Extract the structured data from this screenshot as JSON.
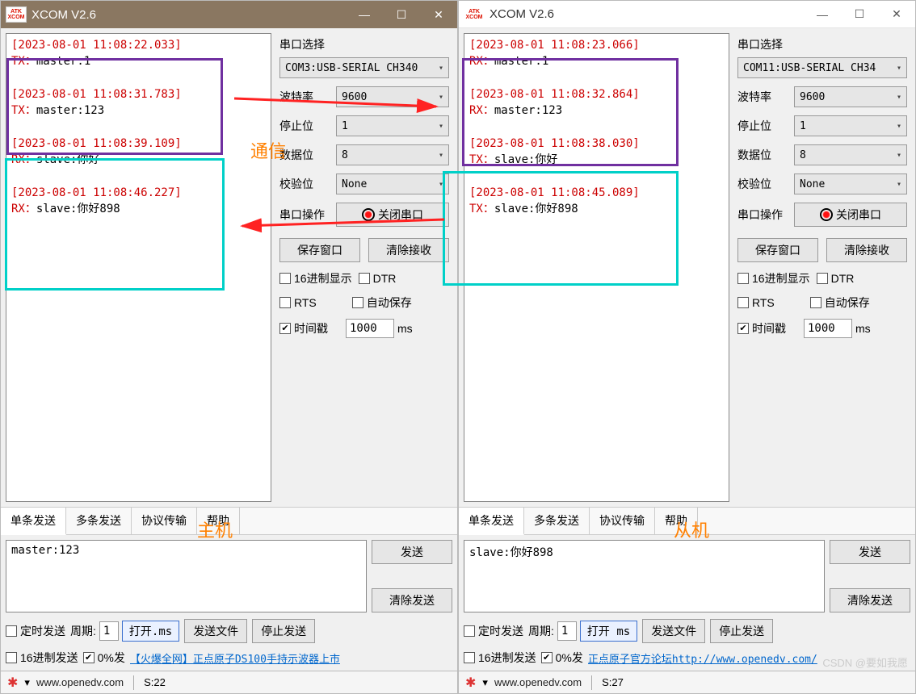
{
  "leftWin": {
    "title": "XCOM V2.6",
    "logoTop": "ATK",
    "logoBot": "XCOM",
    "recv": [
      {
        "ts": "[2023-08-01 11:08:22.033]",
        "dir": "TX：",
        "msg": "master:1"
      },
      {
        "ts": "[2023-08-01 11:08:31.783]",
        "dir": "TX：",
        "msg": "master:123"
      },
      {
        "ts": "[2023-08-01 11:08:39.109]",
        "dir": "RX：",
        "msg": "slave:你好"
      },
      {
        "ts": "[2023-08-01 11:08:46.227]",
        "dir": "RX：",
        "msg": "slave:你好898"
      }
    ],
    "side": {
      "label_select": "串口选择",
      "port": "COM3:USB-SERIAL CH340",
      "baud_label": "波特率",
      "baud": "9600",
      "stop_label": "停止位",
      "stop": "1",
      "data_label": "数据位",
      "data": "8",
      "parity_label": "校验位",
      "parity": "None",
      "op_label": "串口操作",
      "op_btn": "关闭串口",
      "save_win": "保存窗口",
      "clear_recv": "清除接收",
      "hex_disp": "16进制显示",
      "dtr": "DTR",
      "rts": "RTS",
      "autosave": "自动保存",
      "ts_label": "时间戳",
      "ts_val": "1000",
      "ts_unit": "ms"
    },
    "tabs": [
      "单条发送",
      "多条发送",
      "协议传输",
      "帮助"
    ],
    "sendText": "master:123",
    "btn_send": "发送",
    "btn_clear_send": "清除发送",
    "timed": "定时发送",
    "period_label": "周期:",
    "period_val": "1",
    "open_ms": "打开.ms",
    "send_file": "发送文件",
    "stop_send": "停止发送",
    "hex_send": "16进制发送",
    "pct": "0%发",
    "ad": "【火爆全网】正点原子DS100手持示波器上市",
    "status_url": "www.openedv.com",
    "status_s": "S:22"
  },
  "rightWin": {
    "title": "XCOM V2.6",
    "recv": [
      {
        "ts": "[2023-08-01 11:08:23.066]",
        "dir": "RX：",
        "msg": "master:1"
      },
      {
        "ts": "[2023-08-01 11:08:32.864]",
        "dir": "RX：",
        "msg": "master:123"
      },
      {
        "ts": "[2023-08-01 11:08:38.030]",
        "dir": "TX：",
        "msg": "slave:你好"
      },
      {
        "ts": "[2023-08-01 11:08:45.089]",
        "dir": "TX：",
        "msg": "slave:你好898"
      }
    ],
    "side": {
      "label_select": "串口选择",
      "port": "COM11:USB-SERIAL CH34",
      "baud_label": "波特率",
      "baud": "9600",
      "stop_label": "停止位",
      "stop": "1",
      "data_label": "数据位",
      "data": "8",
      "parity_label": "校验位",
      "parity": "None",
      "op_label": "串口操作",
      "op_btn": "关闭串口",
      "save_win": "保存窗口",
      "clear_recv": "清除接收",
      "hex_disp": "16进制显示",
      "dtr": "DTR",
      "rts": "RTS",
      "autosave": "自动保存",
      "ts_label": "时间戳",
      "ts_val": "1000",
      "ts_unit": "ms"
    },
    "tabs": [
      "单条发送",
      "多条发送",
      "协议传输",
      "帮助"
    ],
    "sendText": "slave:你好898",
    "btn_send": "发送",
    "btn_clear_send": "清除发送",
    "timed": "定时发送",
    "period_label": "周期:",
    "period_val": "1",
    "open_ms": "打开 ms",
    "send_file": "发送文件",
    "stop_send": "停止发送",
    "hex_send": "16进制发送",
    "pct": "0%发",
    "ad": "正点原子官方论坛http://www.openedv.com/",
    "status_url": "www.openedv.com",
    "status_s": "S:27"
  },
  "annotations": {
    "comm": "通信",
    "master": "主机",
    "slave": "从机"
  },
  "watermark": "CSDN @要如我愿"
}
